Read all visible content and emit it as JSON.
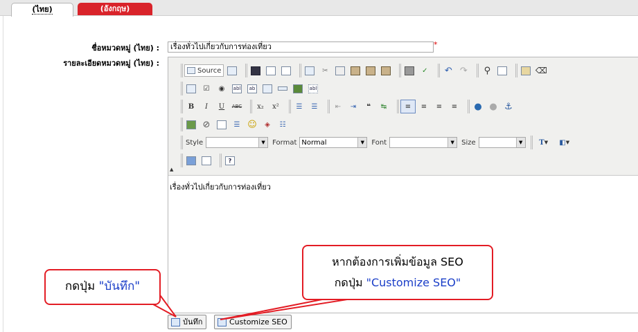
{
  "tabs": [
    {
      "label": "(ไทย)",
      "active": true
    },
    {
      "label": "(อังกฤษ)",
      "active": false
    }
  ],
  "form": {
    "name_label": "ชื่อหมวดหมู่ (ไทย) :",
    "name_value": "เรื่องทั่วไปเกี่ยวกับการท่องเที่ยว",
    "required_mark": "*",
    "detail_label": "รายละเอียดหมวดหมู่ (ไทย) :"
  },
  "editor": {
    "source_label": "Source",
    "style_label": "Style",
    "style_value": "",
    "format_label": "Format",
    "format_value": "Normal",
    "font_label": "Font",
    "font_value": "",
    "size_label": "Size",
    "size_value": "",
    "content_text": "เรื่องทั่วไปเกี่ยวกับการท่องเที่ยว"
  },
  "buttons": {
    "save_label": "บันทึก",
    "seo_label": "Customize SEO"
  },
  "callouts": {
    "save_prefix": "กดปุ่ม ",
    "save_quoted": "\"บันทึก\"",
    "seo_line1": "หากต้องการเพิ่มข้อมูล SEO",
    "seo_line2_prefix": "กดปุ่ม ",
    "seo_line2_quoted": "\"Customize SEO\""
  },
  "colors": {
    "accent_red": "#d9232a",
    "callout_red": "#e31c24",
    "callout_blue": "#1a3ec8"
  }
}
